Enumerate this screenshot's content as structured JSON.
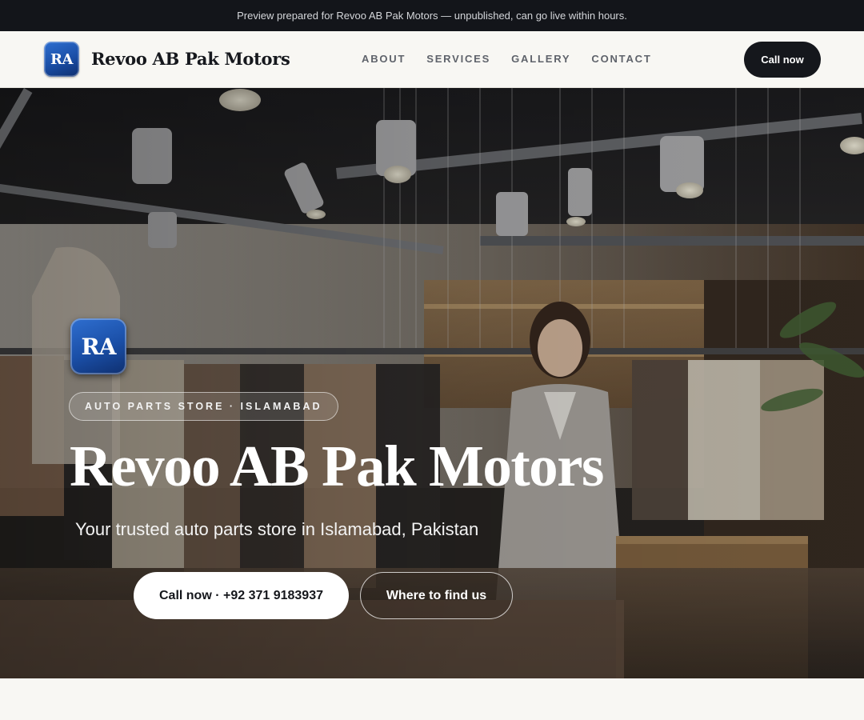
{
  "announcement": {
    "text": "Preview prepared for Revoo AB Pak Motors — unpublished, can go live within hours."
  },
  "navbar": {
    "logo_text": "RA",
    "brand_name": "Revoo AB Pak Motors",
    "links": [
      "ABOUT",
      "SERVICES",
      "GALLERY",
      "CONTACT"
    ],
    "cta_label": "Call now"
  },
  "hero": {
    "logo_text": "RA",
    "badge": "AUTO PARTS STORE · ISLAMABAD",
    "title": "Revoo AB Pak Motors",
    "subtitle": "Your trusted auto parts store in Islamabad, Pakistan",
    "primary_button": "Call now · +92 371 9183937",
    "secondary_button": "Where to find us",
    "background_image": "store-interior-photo"
  },
  "colors": {
    "announcement_bg": "#13151a",
    "dark_button": "#15171c",
    "logo_blue": "#1a4ea6",
    "page_bg": "#f8f7f3"
  }
}
